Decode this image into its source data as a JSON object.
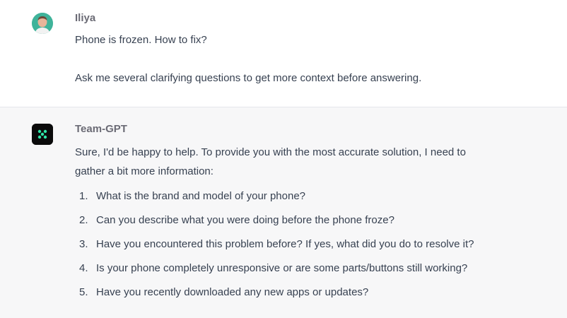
{
  "conversation": {
    "user_message": {
      "author": "Iliya",
      "avatar_icon": "user-avatar-photo",
      "lines": [
        "Phone is frozen. How to fix?",
        "Ask me several clarifying questions to get more context before answering."
      ]
    },
    "assistant_message": {
      "author": "Team-GPT",
      "avatar_icon": "team-gpt-logo",
      "intro_lines": [
        "Sure, I'd be happy to help. To provide you with the most accurate solution, I need to",
        "gather a bit more information:"
      ],
      "questions": [
        {
          "number": "1.",
          "text": "What is the brand and model of your phone?"
        },
        {
          "number": "2.",
          "text": "Can you describe what you were doing before the phone froze?"
        },
        {
          "number": "3.",
          "text": "Have you encountered this problem before? If yes, what did you do to resolve it?"
        },
        {
          "number": "4.",
          "text": "Is your phone completely unresponsive or are some parts/buttons still working?"
        },
        {
          "number": "5.",
          "text": "Have you recently downloaded any new apps or updates?"
        }
      ]
    }
  },
  "colors": {
    "assistant_bg": "#f7f7f8",
    "logo_accent": "#2ee6a8",
    "user_avatar_bg": "#3fb39a"
  }
}
